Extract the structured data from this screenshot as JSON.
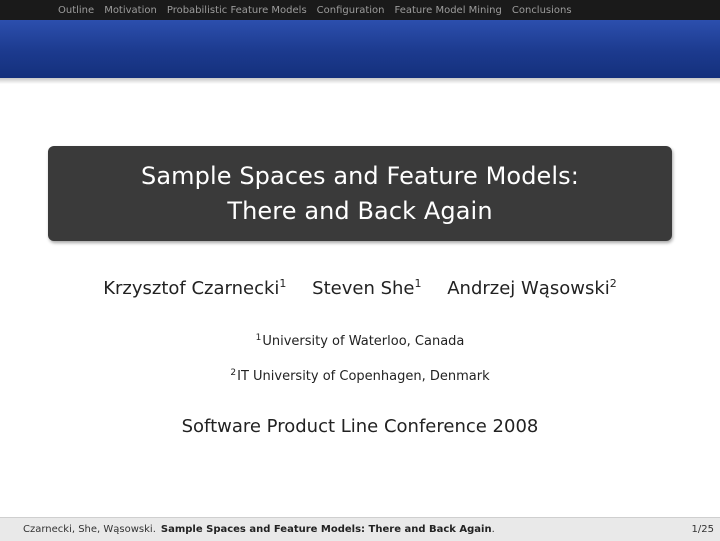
{
  "nav": {
    "items": [
      "Outline",
      "Motivation",
      "Probabilistic Feature Models",
      "Configuration",
      "Feature Model Mining",
      "Conclusions"
    ]
  },
  "title": {
    "line1": "Sample Spaces and Feature Models:",
    "line2": "There and Back Again"
  },
  "authors": [
    {
      "name": "Krzysztof Czarnecki",
      "mark": "1"
    },
    {
      "name": "Steven She",
      "mark": "1"
    },
    {
      "name": "Andrzej Wąsowski",
      "mark": "2"
    }
  ],
  "affiliations": [
    {
      "mark": "1",
      "text": "University of Waterloo, Canada"
    },
    {
      "mark": "2",
      "text": "IT University of Copenhagen, Denmark"
    }
  ],
  "conference": "Software Product Line Conference 2008",
  "footer": {
    "authors": "Czarnecki, She, Wąsowski.",
    "title": "Sample Spaces and Feature Models: There and Back Again",
    "dot": ".",
    "page": "1/25"
  },
  "colors": {
    "nav_background": "#1a1a1a",
    "band": "#1c3a8e",
    "title_box": "#3a3a3a",
    "footer_background": "#e9e9e9"
  }
}
